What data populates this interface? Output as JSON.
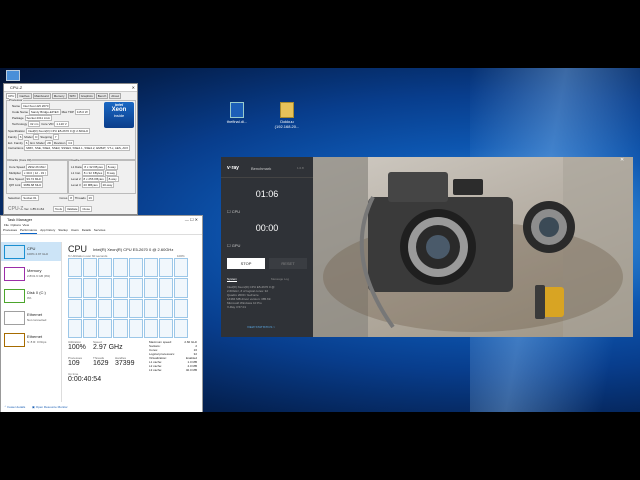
{
  "desktop": {
    "icons": [
      {
        "label": "thefinal.di..."
      },
      {
        "label": "Dokkuu (192.168.20..."
      }
    ]
  },
  "cpuz": {
    "title": "CPU-Z",
    "tabs": [
      "CPU",
      "Caches",
      "Mainboard",
      "Memory",
      "SPD",
      "Graphics",
      "Bench",
      "About"
    ],
    "processor_group": "Processor",
    "rows": [
      {
        "label": "Name",
        "value": "Intel Xeon E5 2670"
      },
      {
        "label": "Code Name",
        "value": "Sandy Bridge-EP/EX"
      },
      {
        "label": "Max TDP",
        "value": "115.0 W"
      },
      {
        "label": "Package",
        "value": "Socket 2011 LGA"
      },
      {
        "label": "Technology",
        "value": "32 nm"
      },
      {
        "label": "Core VID",
        "value": "1.120 V"
      },
      {
        "label": "Specification",
        "value": "Intel(R) Xeon(R) CPU E5-2670 0 @ 2.60GHz"
      },
      {
        "label": "Family",
        "value": "6"
      },
      {
        "label": "Model",
        "value": "D"
      },
      {
        "label": "Stepping",
        "value": "7"
      },
      {
        "label": "Ext. Family",
        "value": "6"
      },
      {
        "label": "Ext. Model",
        "value": "2D"
      },
      {
        "label": "Revision",
        "value": "C2"
      },
      {
        "label": "Instructions",
        "value": "MMX, SSE, SSE2, SSE3, SSSE3, SSE4.1, SSE4.2, EM64T, VT-x, AES, AVX"
      }
    ],
    "clocks_group": "Clocks (Core #0)",
    "clocks": [
      {
        "label": "Core Speed",
        "value": "2992.26 MHz"
      },
      {
        "label": "Multiplier",
        "value": "x 30.0 ( 12 - 33 )"
      },
      {
        "label": "Bus Speed",
        "value": "99.74 MHz"
      },
      {
        "label": "QPI Link",
        "value": "3989.68 MHz"
      }
    ],
    "cache_group": "Cache",
    "cache": [
      {
        "label": "L1 Data",
        "value": "8 x 32 KBytes",
        "way": "8-way"
      },
      {
        "label": "L1 Inst.",
        "value": "8 x 32 KBytes",
        "way": "8-way"
      },
      {
        "label": "Level 2",
        "value": "8 x 256 KBytes",
        "way": "8-way"
      },
      {
        "label": "Level 3",
        "value": "20 MBytes",
        "way": "20-way"
      }
    ],
    "selection_label": "Selection",
    "selection_value": "Socket #1",
    "cores_label": "Cores",
    "cores_value": "8",
    "threads_label": "Threads",
    "threads_value": "16",
    "footer_logo": "CPU-Z",
    "version": "Ver. 1.85.0.x64",
    "tools_btn": "Tools",
    "validate_btn": "Validate",
    "close_btn": "Close",
    "intel_badge_line1": "intel",
    "intel_badge_line2": "Xeon",
    "intel_badge_line3": "inside"
  },
  "taskmgr": {
    "title": "Task Manager",
    "menu": [
      "File",
      "Options",
      "View"
    ],
    "tabs": [
      "Processes",
      "Performance",
      "App history",
      "Startup",
      "Users",
      "Details",
      "Services"
    ],
    "side": [
      {
        "label": "CPU",
        "sub": "100% 2.97 GHz",
        "color": "#1a8fd1"
      },
      {
        "label": "Memory",
        "sub": "2.8/31.9 GB (9%)",
        "color": "#9b2ea8"
      },
      {
        "label": "Disk 0 (C:)",
        "sub": "0%",
        "color": "#4ca52c"
      },
      {
        "label": "Ethernet",
        "sub": "Not connected",
        "color": "#a0a0a0"
      },
      {
        "label": "Ethernet",
        "sub": "S: 8 R: 0 Kbps",
        "color": "#a66b00"
      }
    ],
    "main_title": "CPU",
    "cpu_name": "Intel(R) Xeon(R) CPU E5-2670 0 @ 2.60GHz",
    "util_label": "% Utilization over 60 seconds",
    "util_max": "100%",
    "utilization_label": "Utilization",
    "utilization": "100%",
    "speed_label": "Speed",
    "speed": "2.97 GHz",
    "processes_label": "Processes",
    "processes": "109",
    "threads_label": "Threads",
    "threads": "1629",
    "handles_label": "Handles",
    "handles": "37399",
    "uptime_label": "Up time",
    "uptime": "0:00:40:54",
    "details": [
      {
        "k": "Maximum speed:",
        "v": "2.60 GHz"
      },
      {
        "k": "Sockets:",
        "v": "2"
      },
      {
        "k": "Cores:",
        "v": "16"
      },
      {
        "k": "Logical processors:",
        "v": "32"
      },
      {
        "k": "Virtualization:",
        "v": "Enabled"
      },
      {
        "k": "L1 cache:",
        "v": "1.0 MB"
      },
      {
        "k": "L2 cache:",
        "v": "4.0 MB"
      },
      {
        "k": "L3 cache:",
        "v": "40.0 MB"
      }
    ],
    "fewer_details": "Fewer details",
    "open_monitor": "Open Resource Monitor"
  },
  "vray": {
    "logo": "v·ray",
    "title": "Benchmark",
    "version": "1.0.8",
    "cpu_time": "01:06",
    "cpu_label": "CPU",
    "gpu_time": "00:00",
    "gpu_label": "GPU",
    "stop_label": "STOP",
    "reset_label": "RESET",
    "tab_system": "System",
    "tab_log": "Message Log",
    "sys_info": [
      "Intel(R) Xeon(R) CPU E5-2670 0 @",
      "2.60GHz, # of logical cores: 32",
      "Quadro 2000 / GeForce",
      "16384 MB driver version: 385.69",
      "Microsoft Windows 10 Pro",
      "V-Ray 3.57.01"
    ],
    "view_stats": "VIEW STATISTICS >"
  },
  "colors": {
    "accent": "#1a8fd1",
    "vray_bg": "#2f3237"
  }
}
